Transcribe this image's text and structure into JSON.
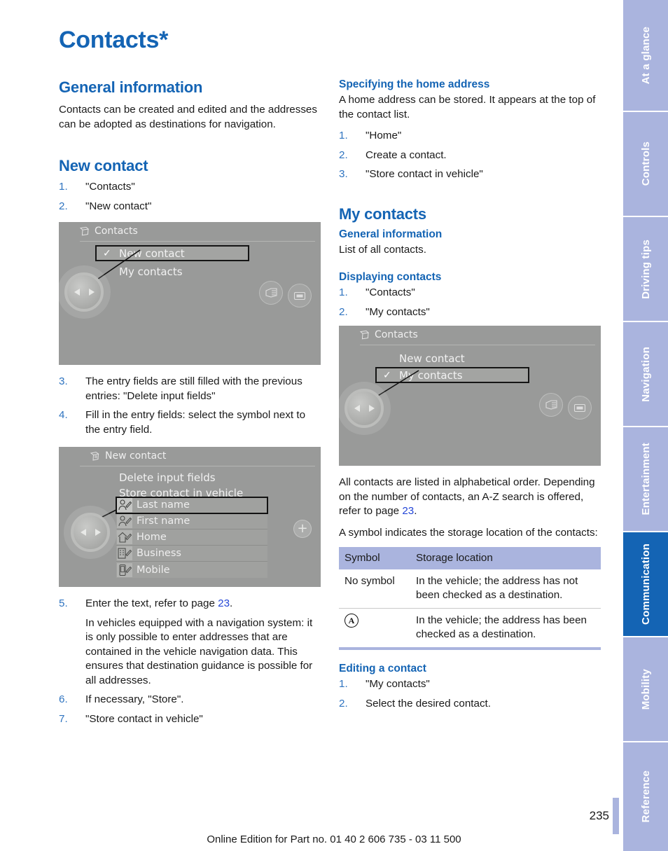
{
  "document": {
    "title": "Contacts*",
    "page_number": "235",
    "footer": "Online Edition for Part no. 01 40 2 606 735 - 03 11 500"
  },
  "colors": {
    "accent_blue": "#1464b4",
    "tab_inactive": "#aab4de",
    "link_blue": "#2446d7",
    "list_number": "#2f74c0"
  },
  "left_column": {
    "general_information": {
      "heading": "General information",
      "body": "Contacts can be created and edited and the addresses can be adopted as destinations for navigation."
    },
    "new_contact": {
      "heading": "New contact",
      "steps_before": [
        {
          "num": "1.",
          "text": "\"Contacts\""
        },
        {
          "num": "2.",
          "text": "\"New contact\""
        }
      ],
      "screenshot_contacts": {
        "header_title": "Contacts",
        "header_icon": "contacts-book-icon",
        "items": [
          {
            "label": "New contact",
            "selected": true,
            "checked": true
          },
          {
            "label": "My contacts",
            "selected": false,
            "checked": false
          }
        ],
        "controller_icon": "idrive-controller-icon",
        "right_buttons": [
          "menu-button-icon",
          "display-button-icon"
        ]
      },
      "steps_middle": [
        {
          "num": "3.",
          "text": "The entry fields are still filled with the previous entries: \"Delete input fields\""
        },
        {
          "num": "4.",
          "text": "Fill in the entry fields: select the symbol next to the entry field."
        }
      ],
      "screenshot_new_contact": {
        "header_title": "New contact",
        "header_icon": "new-contact-icon",
        "actions": [
          "Delete input fields",
          "Store contact in vehicle"
        ],
        "fields": [
          {
            "label": "Last name",
            "icon": "person-edit-icon",
            "selected": true
          },
          {
            "label": "First name",
            "icon": "person-edit-icon",
            "selected": false
          },
          {
            "label": "Home",
            "icon": "home-edit-icon",
            "selected": false
          },
          {
            "label": "Business",
            "icon": "business-edit-icon",
            "selected": false
          },
          {
            "label": "Mobile",
            "icon": "mobile-edit-icon",
            "selected": false
          }
        ],
        "plus_button": "+"
      },
      "steps_after": [
        {
          "num": "5.",
          "text_pre": "Enter the text, refer to page ",
          "page_ref": "23",
          "text_post": ".",
          "sub": "In vehicles equipped with a navigation system: it is only possible to enter addresses that are contained in the vehicle navigation data. This ensures that destination guidance is possible for all addresses."
        },
        {
          "num": "6.",
          "text": "If necessary, \"Store\"."
        },
        {
          "num": "7.",
          "text": "\"Store contact in vehicle\""
        }
      ]
    }
  },
  "right_column": {
    "home_address": {
      "heading": "Specifying the home address",
      "body": "A home address can be stored. It appears at the top of the contact list.",
      "steps": [
        {
          "num": "1.",
          "text": "\"Home\""
        },
        {
          "num": "2.",
          "text": "Create a contact."
        },
        {
          "num": "3.",
          "text": "\"Store contact in vehicle\""
        }
      ]
    },
    "my_contacts": {
      "heading": "My contacts",
      "general_information": {
        "heading": "General information",
        "body": "List of all contacts."
      },
      "displaying_contacts": {
        "heading": "Displaying contacts",
        "steps": [
          {
            "num": "1.",
            "text": "\"Contacts\""
          },
          {
            "num": "2.",
            "text": "\"My contacts\""
          }
        ]
      },
      "screenshot_my_contacts": {
        "header_title": "Contacts",
        "header_icon": "contacts-book-icon",
        "items": [
          {
            "label": "New contact",
            "selected": false,
            "checked": false
          },
          {
            "label": "My contacts",
            "selected": true,
            "checked": true
          }
        ],
        "controller_icon": "idrive-controller-icon",
        "right_buttons": [
          "menu-button-icon",
          "display-button-icon"
        ]
      },
      "after_text_1_pre": "All contacts are listed in alphabetical order. Depending on the number of contacts, an A-Z search is offered, refer to page ",
      "after_text_1_ref": "23",
      "after_text_1_post": ".",
      "after_text_2": "A symbol indicates the storage location of the contacts:",
      "table": {
        "headers": [
          "Symbol",
          "Storage location"
        ],
        "rows": [
          {
            "symbol_text": "No symbol",
            "symbol_icon": null,
            "location": "In the vehicle; the address has not been checked as a destination."
          },
          {
            "symbol_text": "",
            "symbol_icon": "navigation-destination-icon",
            "location": "In the vehicle; the address has been checked as a destination."
          }
        ]
      },
      "editing_a_contact": {
        "heading": "Editing a contact",
        "steps": [
          {
            "num": "1.",
            "text": "\"My contacts\""
          },
          {
            "num": "2.",
            "text": "Select the desired contact."
          }
        ]
      }
    }
  },
  "tabs": [
    {
      "label": "At a glance",
      "active": false
    },
    {
      "label": "Controls",
      "active": false
    },
    {
      "label": "Driving tips",
      "active": false
    },
    {
      "label": "Navigation",
      "active": false
    },
    {
      "label": "Entertainment",
      "active": false
    },
    {
      "label": "Communication",
      "active": true
    },
    {
      "label": "Mobility",
      "active": false
    },
    {
      "label": "Reference",
      "active": false
    }
  ]
}
